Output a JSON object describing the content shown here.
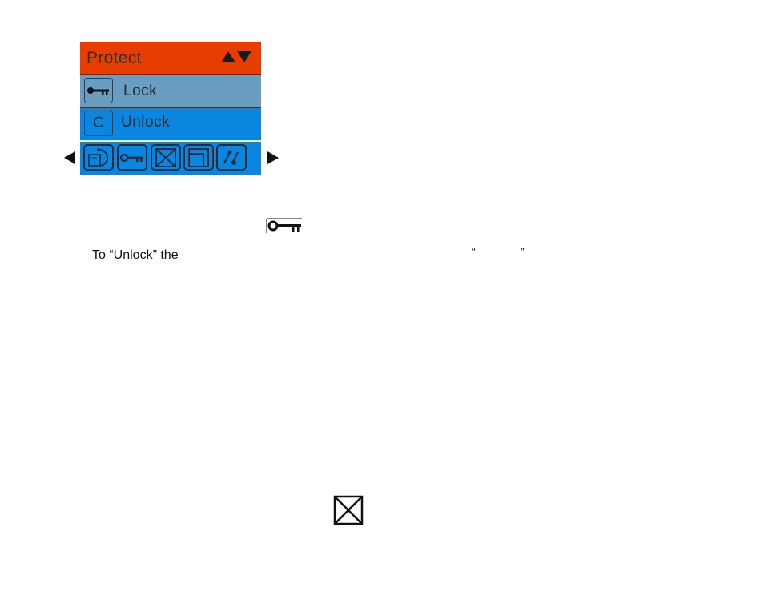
{
  "menu": {
    "title": "Protect",
    "title_nav_icons": [
      "arrow-up-icon",
      "arrow-down-icon"
    ],
    "items": [
      {
        "label": "Lock",
        "icon": "key-icon",
        "selected": true
      },
      {
        "label": "Unlock",
        "icon_text": "C",
        "selected": false
      }
    ],
    "toolbar": [
      {
        "name": "rotate-icon",
        "glyph_text": "T"
      },
      {
        "name": "key-icon"
      },
      {
        "name": "delete-icon"
      },
      {
        "name": "frame-icon"
      },
      {
        "name": "edit-icon"
      }
    ],
    "nav": {
      "prev": "arrow-left-icon",
      "next": "arrow-right-icon"
    },
    "colors": {
      "title_bar": "#e83d00",
      "selected_row": "#6a9ec0",
      "row": "#0a86e0",
      "toolbar": "#0a86e0"
    }
  },
  "document": {
    "inline_icons": [
      "key-icon",
      "delete-icon"
    ],
    "body_text": "To “Unlock” the",
    "quote_open": "“",
    "quote_close": "”"
  }
}
